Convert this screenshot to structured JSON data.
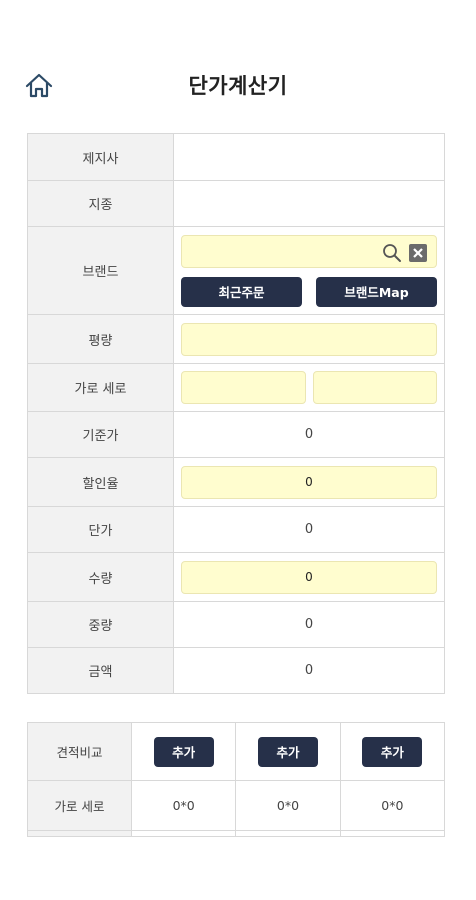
{
  "header": {
    "title": "단가계산기",
    "home_icon": "home-icon"
  },
  "calculator": {
    "rows": {
      "paper_company": {
        "label": "제지사",
        "value": ""
      },
      "paper_type": {
        "label": "지종",
        "value": ""
      },
      "brand": {
        "label": "브랜드",
        "value": "",
        "search_icon": "search-icon",
        "clear_icon": "clear-icon",
        "recent_order_button": "최근주문",
        "brand_map_button": "브랜드Map"
      },
      "basis_weight": {
        "label": "평량",
        "value": ""
      },
      "width_height": {
        "label": "가로 세로",
        "width_value": "",
        "height_value": ""
      },
      "base_price": {
        "label": "기준가",
        "value": "0"
      },
      "discount_rate": {
        "label": "할인율",
        "value": "0"
      },
      "unit_price": {
        "label": "단가",
        "value": "0"
      },
      "quantity": {
        "label": "수량",
        "value": "0"
      },
      "weight": {
        "label": "중량",
        "value": "0"
      },
      "amount": {
        "label": "금액",
        "value": "0"
      }
    }
  },
  "comparison": {
    "label": "견적비교",
    "add_button": "추가",
    "size_row_label": "가로 세로",
    "columns": [
      "0*0",
      "0*0",
      "0*0"
    ]
  },
  "colors": {
    "accent_navy": "#263049",
    "input_yellow": "#fffdcf",
    "label_bg": "#f2f2f2"
  }
}
